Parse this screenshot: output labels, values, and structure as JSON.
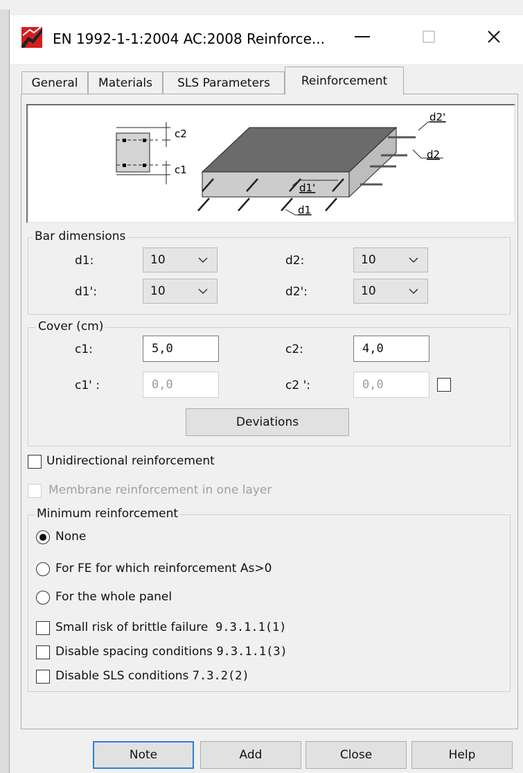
{
  "window": {
    "title": "EN 1992-1-1:2004 AC:2008 Reinforce..."
  },
  "tabs": [
    {
      "label": "General"
    },
    {
      "label": "Materials"
    },
    {
      "label": "SLS Parameters"
    },
    {
      "label": "Reinforcement",
      "active": true
    }
  ],
  "figure": {
    "labels": {
      "c2": "c2",
      "c1": "c1",
      "d1": "d1",
      "d1p": "d1'",
      "d2": "d2",
      "d2p": "d2'"
    }
  },
  "bar_dimensions": {
    "legend": "Bar dimensions",
    "d1": {
      "label": "d1:",
      "value": "10"
    },
    "d2": {
      "label": "d2:",
      "value": "10"
    },
    "d1p": {
      "label": "d1':",
      "value": "10"
    },
    "d2p": {
      "label": "d2':",
      "value": "10"
    }
  },
  "cover": {
    "legend": "Cover (cm)",
    "c1": {
      "label": "c1:",
      "value": "5,0"
    },
    "c2": {
      "label": "c2:",
      "value": "4,0"
    },
    "c1p": {
      "label": "c1' :",
      "value": "0,0"
    },
    "c2p": {
      "label": "c2 ':",
      "value": "0,0"
    },
    "c2p_checked": false,
    "deviations_label": "Deviations"
  },
  "options": {
    "unidirectional": {
      "label": "Unidirectional reinforcement",
      "checked": false
    },
    "membrane": {
      "label": "Membrane reinforcement in one layer",
      "checked": false,
      "disabled": true
    }
  },
  "minimum": {
    "legend": "Minimum reinforcement",
    "radios": [
      {
        "label": "None",
        "selected": true
      },
      {
        "label": "For FE for which reinforcement As>0",
        "selected": false
      },
      {
        "label": "For the whole panel",
        "selected": false
      }
    ],
    "checks": [
      {
        "label": "Small risk of brittle failure",
        "ref": "9.3.1.1(1)",
        "checked": false
      },
      {
        "label": "Disable spacing conditions",
        "ref": "9.3.1.1(3)",
        "checked": false
      },
      {
        "label": "Disable SLS conditions",
        "ref": "7.3.2(2)",
        "checked": false
      }
    ]
  },
  "footer": {
    "note": "Note",
    "add": "Add",
    "close": "Close",
    "help": "Help"
  },
  "colors": {
    "accent": "#2a7fd6",
    "app_icon_red": "#d21f1f",
    "slab_top": "#6b6b6b",
    "slab_side": "#c8c8c8"
  }
}
